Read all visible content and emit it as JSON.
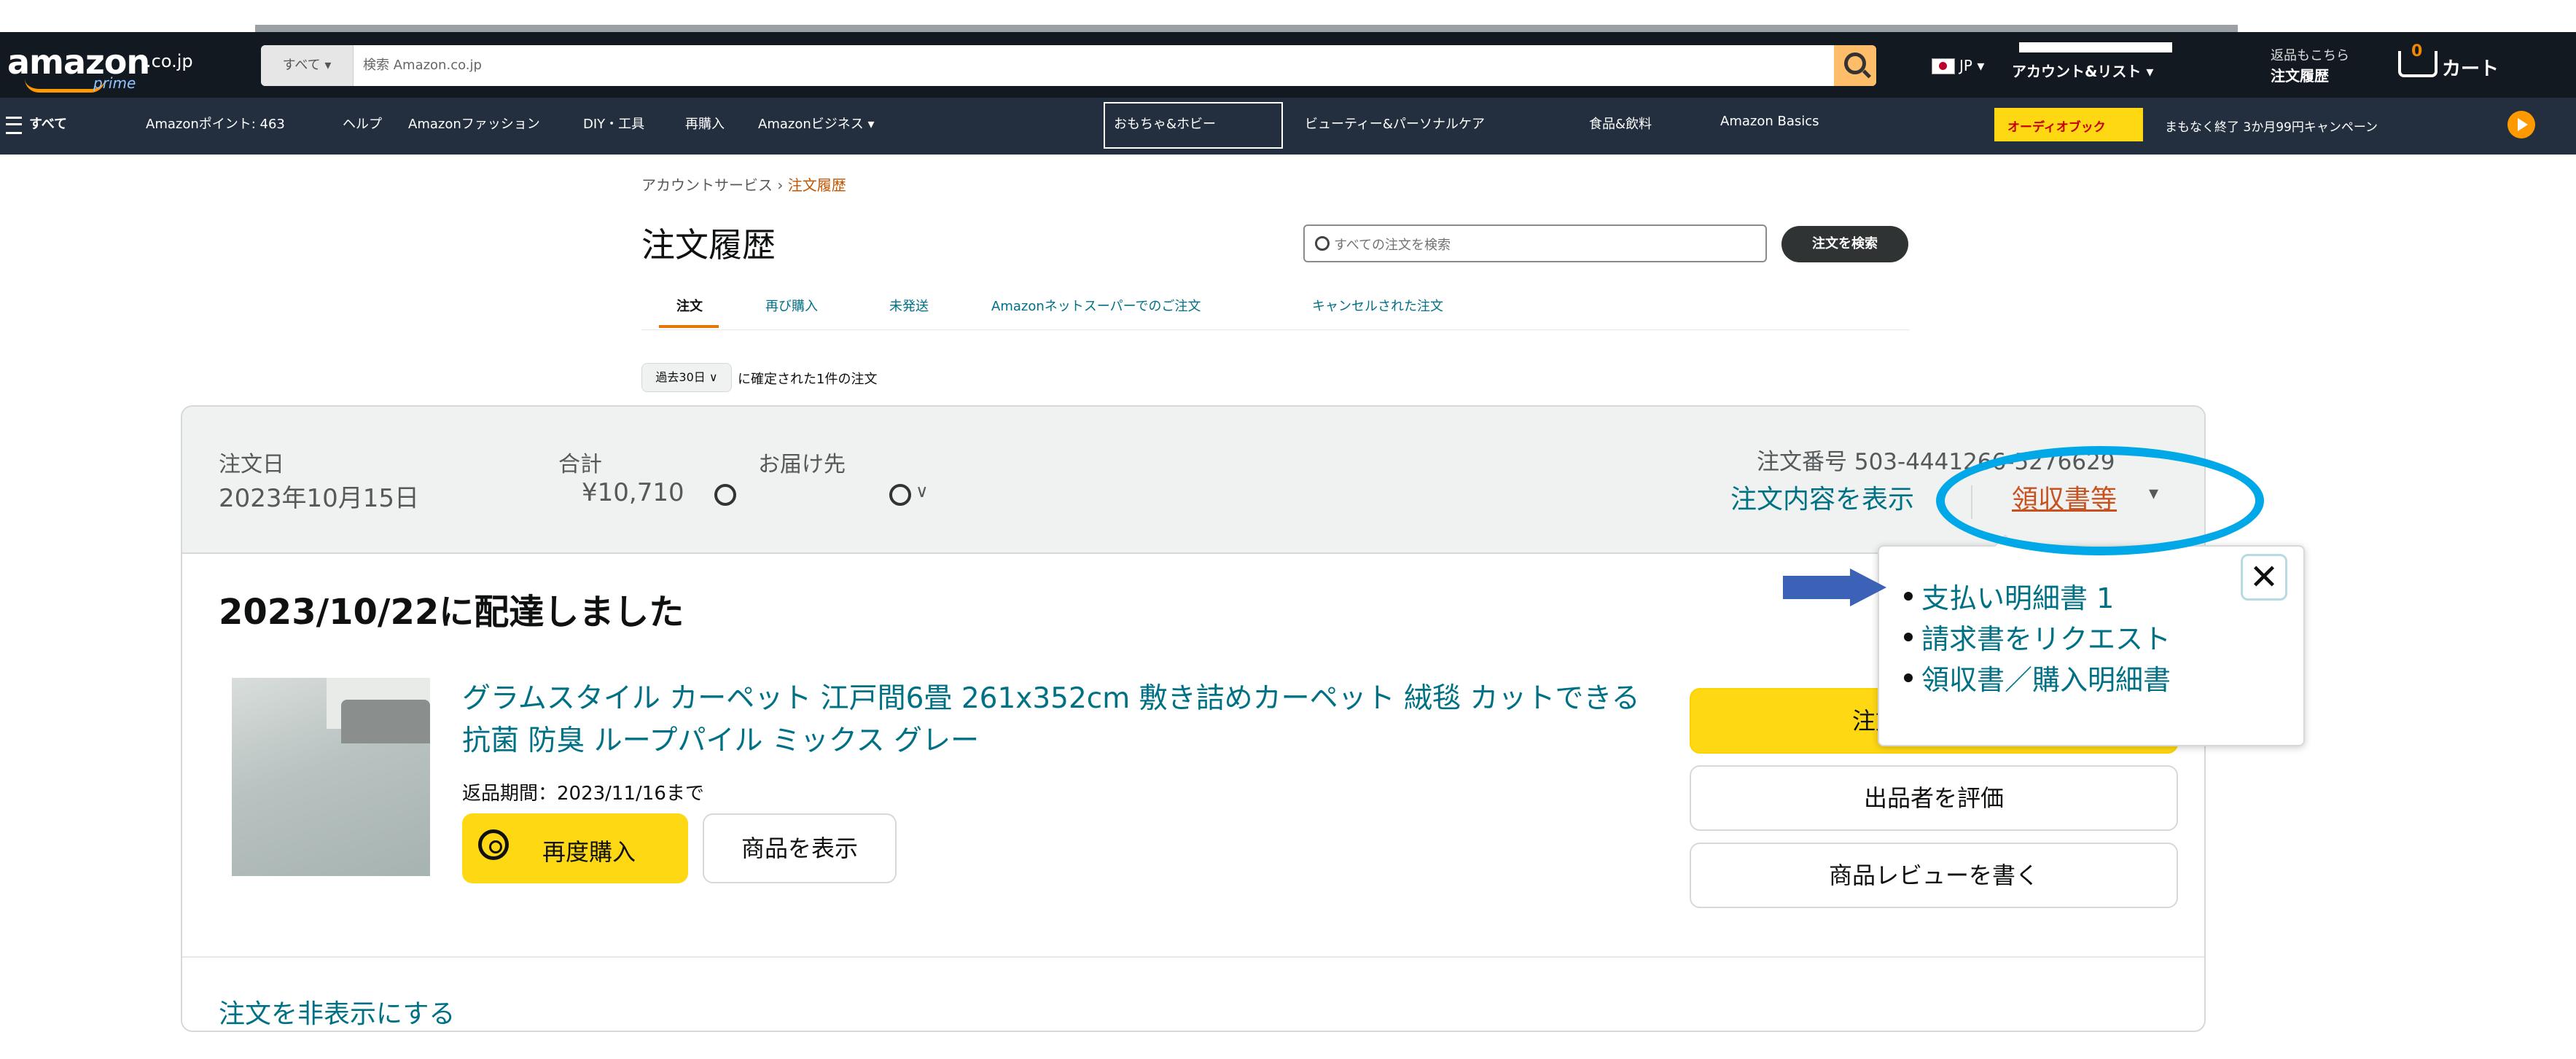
{
  "header": {
    "logo_word": "amazon",
    "logo_tld": ".co.jp",
    "logo_prime": "prime",
    "search_category": "すべて ▾",
    "search_placeholder": "検索 Amazon.co.jp",
    "language": "JP ▾",
    "account_label": "アカウント&リスト ▾",
    "returns_line1": "返品もこちら",
    "returns_line2": "注文履歴",
    "cart_count": "0",
    "cart_label": "カート"
  },
  "subnav": {
    "all": "すべて",
    "items": [
      "Amazonポイント: 463",
      "ヘルプ",
      "Amazonファッション",
      "DIY・工具",
      "再購入",
      "Amazonビジネス ▾",
      "おもちゃ&ホビー",
      "ビューティー&パーソナルケア",
      "食品&飲料",
      "Amazon Basics"
    ],
    "promo_tag": "オーディオブック",
    "promo_text": "まもなく終了 3か月99円キャンペーン"
  },
  "page": {
    "breadcrumb_parent": "アカウントサービス",
    "breadcrumb_sep": "›",
    "breadcrumb_current": "注文履歴",
    "title": "注文履歴",
    "order_search_placeholder": "すべての注文を検索",
    "order_search_button": "注文を検索",
    "tabs": [
      "注文",
      "再び購入",
      "未発送",
      "Amazonネットスーパーでのご注文",
      "キャンセルされた注文"
    ],
    "range_select": "過去30日 ∨",
    "range_suffix": "に確定された1件の注文"
  },
  "order": {
    "date_label": "注文日",
    "date_value": "2023年10月15日",
    "total_label": "合計",
    "total_value": "¥10,710",
    "shipto_label": "お届け先",
    "order_number": "注文番号 503-4441266-5276629",
    "view_details": "注文内容を表示",
    "receipt_link": "領収書等",
    "receipt_caret": "▾",
    "status": "2023/10/22に配達しました",
    "product_name": "グラムスタイル カーペット 江戸間6畳 261x352cm 敷き詰めカーペット 絨毯 カットできる 抗菌 防臭 ループパイル ミックス グレー",
    "return_window": "返品期間：2023/11/16まで",
    "buy_again": "再度購入",
    "view_item": "商品を表示",
    "right_buttons": [
      "注文内容を表示",
      "出品者を評価",
      "商品レビューを書く"
    ],
    "hide_order": "注文を非表示にする"
  },
  "receipt_popover": {
    "items": [
      "支払い明細書 1",
      "請求書をリクエスト",
      "領収書／購入明細書"
    ],
    "close": "✕"
  },
  "colors": {
    "nav_dark": "#131921",
    "nav_secondary": "#232f3e",
    "link": "#007185",
    "accent_yellow": "#ffd814",
    "annotation_circle": "#00a8e8",
    "annotation_arrow": "#3c62b8"
  }
}
